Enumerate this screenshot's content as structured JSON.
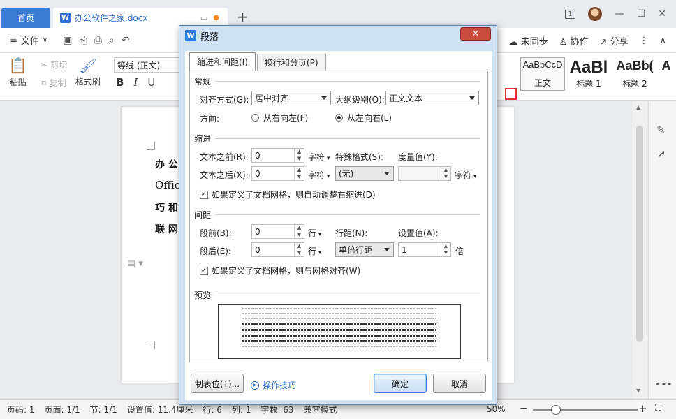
{
  "tabs": {
    "home": "首页",
    "doc_name": "办公软件之家.docx",
    "plus": "+"
  },
  "window": {
    "badge": "1",
    "min": "—",
    "max": "☐",
    "close": "✕"
  },
  "menubar": {
    "file_label": "文件",
    "unsynced": "未同步",
    "collab": "协作",
    "share": "分享"
  },
  "ribbon": {
    "paste": "粘贴",
    "cut": "剪切",
    "copy": "复制",
    "format_painter": "格式刷",
    "font_name": "等线 (正文)",
    "bold": "B",
    "italic": "I",
    "underline": "U",
    "styles": [
      {
        "sample": "AaBbCcD",
        "label": "正文"
      },
      {
        "sample": "AaBl",
        "label": "标题 1"
      },
      {
        "sample": "AaBb(",
        "label": "标题 2"
      },
      {
        "sample": "A",
        "label": ""
      }
    ]
  },
  "document": {
    "lines": [
      "办 公",
      "Offic",
      "巧 和",
      "联 网"
    ]
  },
  "status": {
    "page_no": "页码: 1",
    "pages": "页面: 1/1",
    "section": "节: 1/1",
    "setting": "设置值: 11.4厘米",
    "row": "行: 6",
    "col": "列: 1",
    "words": "字数: 63",
    "compat": "兼容模式",
    "zoom": "50%"
  },
  "dialog": {
    "title": "段落",
    "close": "✕",
    "tab_indent": "缩进和间距(I)",
    "tab_break": "换行和分页(P)",
    "sec_general": "常规",
    "align_label": "对齐方式(G):",
    "align_value": "居中对齐",
    "outline_label": "大纲级别(O):",
    "outline_value": "正文文本",
    "direction_label": "方向:",
    "rtl": "从右向左(F)",
    "ltr": "从左向右(L)",
    "sec_indent": "缩进",
    "before_text_label": "文本之前(R):",
    "before_text_value": "0",
    "after_text_label": "文本之后(X):",
    "after_text_value": "0",
    "unit_char": "字符",
    "special_label": "特殊格式(S):",
    "special_value": "(无)",
    "measure_label": "度量值(Y):",
    "measure_value": "",
    "auto_indent": "如果定义了文档网格，则自动调整右缩进(D)",
    "sec_spacing": "间距",
    "before_label": "段前(B):",
    "before_value": "0",
    "after_label": "段后(E):",
    "after_value": "0",
    "unit_line": "行",
    "line_spacing_label": "行距(N):",
    "line_spacing_value": "单倍行距",
    "set_value_label": "设置值(A):",
    "set_value": "1",
    "unit_times": "倍",
    "snap_grid": "如果定义了文档网格，则与网格对齐(W)",
    "sec_preview": "预览",
    "tabs_button": "制表位(T)...",
    "tips": "操作技巧",
    "ok": "确定",
    "cancel": "取消"
  },
  "colors": {
    "accent": "#3a7bd5",
    "dialog_frame": "#cfe1f5",
    "close_red": "#c94c3e",
    "highlight_red": "#e23333"
  }
}
